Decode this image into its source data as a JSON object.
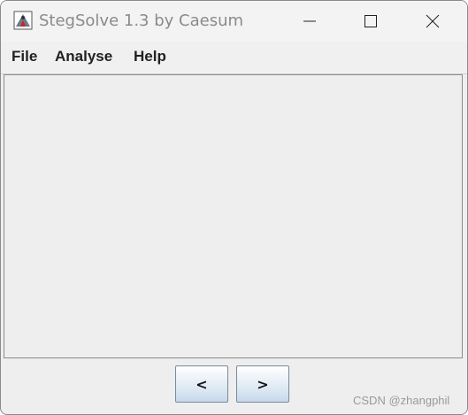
{
  "window": {
    "title": "StegSolve 1.3 by Caesum"
  },
  "menu": {
    "items": [
      "File",
      "Analyse",
      "Help"
    ]
  },
  "navigation": {
    "prev_label": "<",
    "next_label": ">"
  },
  "watermark": "CSDN @zhangphil",
  "icons": {
    "app": "java-app-icon",
    "minimize": "minimize-icon",
    "maximize": "maximize-icon",
    "close": "close-icon"
  },
  "colors": {
    "window_bg": "#eeeeee",
    "button_gradient_bottom": "#c7d8ea",
    "title_text": "#8a8a8a"
  }
}
